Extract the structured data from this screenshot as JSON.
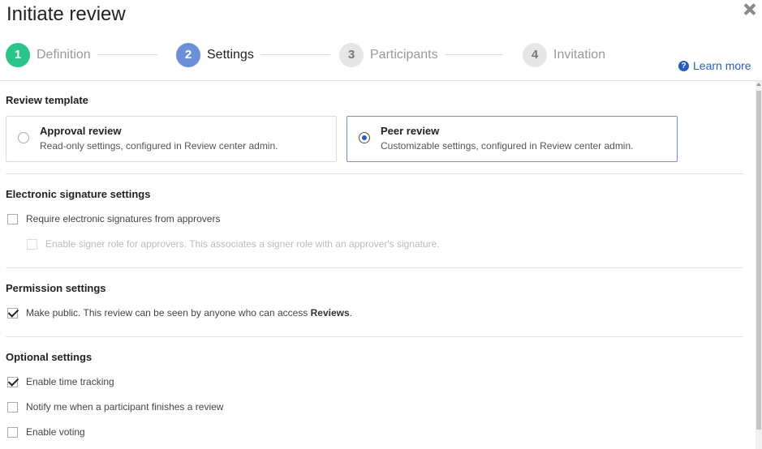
{
  "header": {
    "title": "Initiate review",
    "learn_more": "Learn more"
  },
  "steps": [
    {
      "number": "1",
      "label": "Definition",
      "state": "complete"
    },
    {
      "number": "2",
      "label": "Settings",
      "state": "active"
    },
    {
      "number": "3",
      "label": "Participants",
      "state": "upcoming"
    },
    {
      "number": "4",
      "label": "Invitation",
      "state": "upcoming"
    }
  ],
  "review_template": {
    "heading": "Review template",
    "options": [
      {
        "title": "Approval review",
        "description": "Read-only settings, configured in Review center admin.",
        "selected": false
      },
      {
        "title": "Peer review",
        "description": "Customizable settings, configured in Review center admin.",
        "selected": true
      }
    ]
  },
  "esign": {
    "heading": "Electronic signature settings",
    "require_label": "Require electronic signatures from approvers",
    "require_checked": false,
    "signer_label": "Enable signer role for approvers. This associates a signer role with an approver's signature.",
    "signer_checked": false,
    "signer_disabled": true
  },
  "permission": {
    "heading": "Permission settings",
    "public_label_prefix": "Make public. This review can be seen by anyone who can access ",
    "public_label_bold": "Reviews",
    "public_label_suffix": ".",
    "public_checked": true
  },
  "optional": {
    "heading": "Optional settings",
    "items": [
      {
        "label": "Enable time tracking",
        "checked": true
      },
      {
        "label": "Notify me when a participant finishes a review",
        "checked": false
      },
      {
        "label": "Enable voting",
        "checked": false
      }
    ]
  },
  "colors": {
    "step_complete": "#2bc48a",
    "step_active": "#6c8fd8",
    "link": "#2a5cbf",
    "selected_border": "#6c8fd8"
  },
  "icons": {
    "close": "close-icon",
    "help": "help-icon",
    "check": "checkmark-icon"
  }
}
